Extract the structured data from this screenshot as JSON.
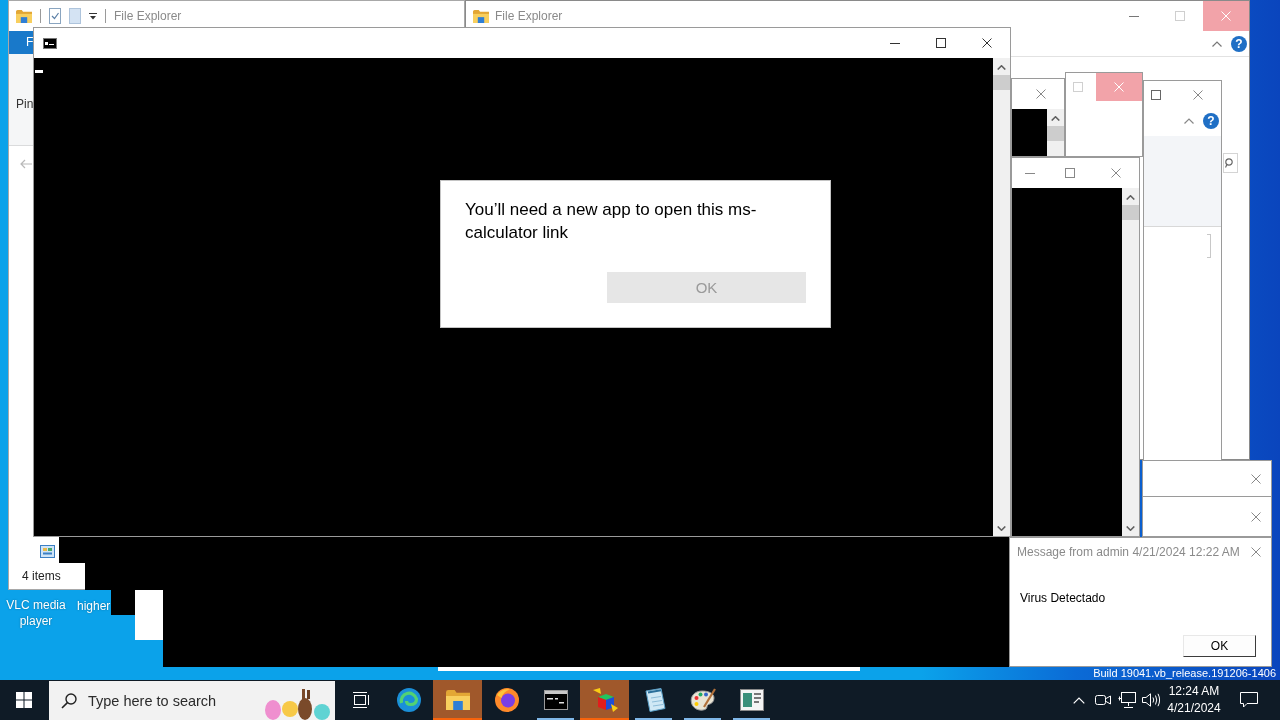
{
  "explorer_windows": [
    {
      "title": "File Explorer",
      "ribbon_tab": "F",
      "ribbon_label": "Pin",
      "status_text": "4 items"
    },
    {
      "title": "File Explorer",
      "help_label": "?",
      "close_hover": true
    },
    {
      "help_label": "?"
    }
  ],
  "side_window": {
    "close_hover": true
  },
  "console_window": {
    "dialog": {
      "message": "You’ll need a new app to open this ms-calculator link",
      "button": {
        "label": "OK",
        "disabled": true
      }
    }
  },
  "message_box": {
    "title": "Message from admin 4/21/2024 12:22 AM",
    "body": "Virus Detectado",
    "button": "OK"
  },
  "desktop_icons": [
    {
      "label": "VLC media player"
    },
    {
      "label": "higher"
    }
  ],
  "build_info": "Build 19041.vb_release.191206-1406",
  "taskbar": {
    "search": {
      "placeholder": "Type here to search"
    },
    "apps": [
      {
        "kind": "swirl",
        "running": false,
        "flashing": false
      },
      {
        "kind": "folder",
        "running": true,
        "flashing": true
      },
      {
        "kind": "globe",
        "running": false,
        "flashing": false
      },
      {
        "kind": "terminal",
        "running": true,
        "flashing": false
      },
      {
        "kind": "cube",
        "running": true,
        "flashing": true
      },
      {
        "kind": "notepad",
        "running": true,
        "flashing": false
      },
      {
        "kind": "palette",
        "running": true,
        "flashing": false
      },
      {
        "kind": "window",
        "running": true,
        "flashing": false
      }
    ],
    "clock": {
      "time": "12:24 AM",
      "date": "4/21/2024"
    }
  }
}
